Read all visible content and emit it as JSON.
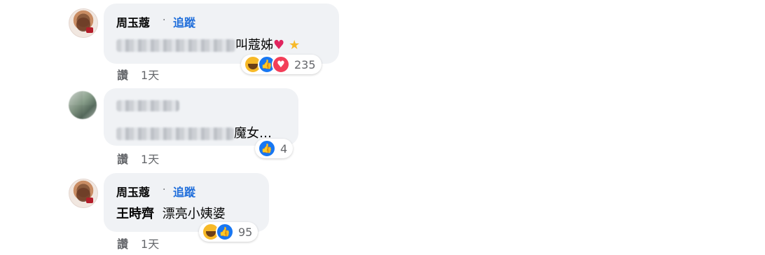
{
  "comments": [
    {
      "author": "周玉蔻",
      "dot": "·",
      "follow": "追蹤",
      "text_visible": "叫蔻姊",
      "heart": "♥",
      "star": "★",
      "like_label": "讚",
      "time": "1天",
      "reaction_count": "235",
      "reactions": [
        "haha-icon",
        "like-icon",
        "love-icon"
      ]
    },
    {
      "author": "",
      "text_visible": "魔女…",
      "like_label": "讚",
      "time": "1天",
      "reaction_count": "4",
      "reactions": [
        "like-icon"
      ]
    },
    {
      "author": "周玉蔻",
      "dot": "·",
      "follow": "追蹤",
      "tag": "王時齊",
      "text_visible": "漂亮小姨婆",
      "like_label": "讚",
      "time": "1天",
      "reaction_count": "95",
      "reactions": [
        "haha-icon",
        "like-icon"
      ]
    }
  ],
  "colors": {
    "bubble": "#f0f2f5",
    "follow": "#216fdb",
    "meta": "#65676b",
    "like": "#1877f2",
    "love": "#f33e58",
    "haha": "#f7b928"
  }
}
